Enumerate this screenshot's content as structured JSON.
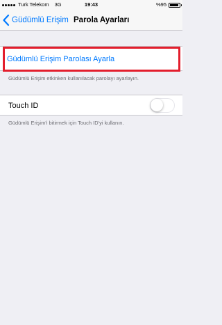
{
  "status_bar": {
    "carrier": "Turk Telekom",
    "network": "3G",
    "time": "19:43",
    "battery_text": "%95",
    "battery_level": 0.95
  },
  "nav": {
    "back_label": "Güdümlü Erişim",
    "title": "Parola Ayarları"
  },
  "settings": {
    "set_passcode_label": "Güdümlü Erişim Parolası Ayarla",
    "passcode_footer": "Güdümlü Erişim etkinken kullanılacak parolayı ayarlayın.",
    "touch_id_label": "Touch ID",
    "touch_id_enabled": false,
    "touch_id_footer": "Güdümlü Erişim'i bitirmek için Touch ID'yi kullanın."
  },
  "colors": {
    "accent": "#007aff",
    "highlight": "#e31e2d",
    "background": "#efeff4"
  }
}
